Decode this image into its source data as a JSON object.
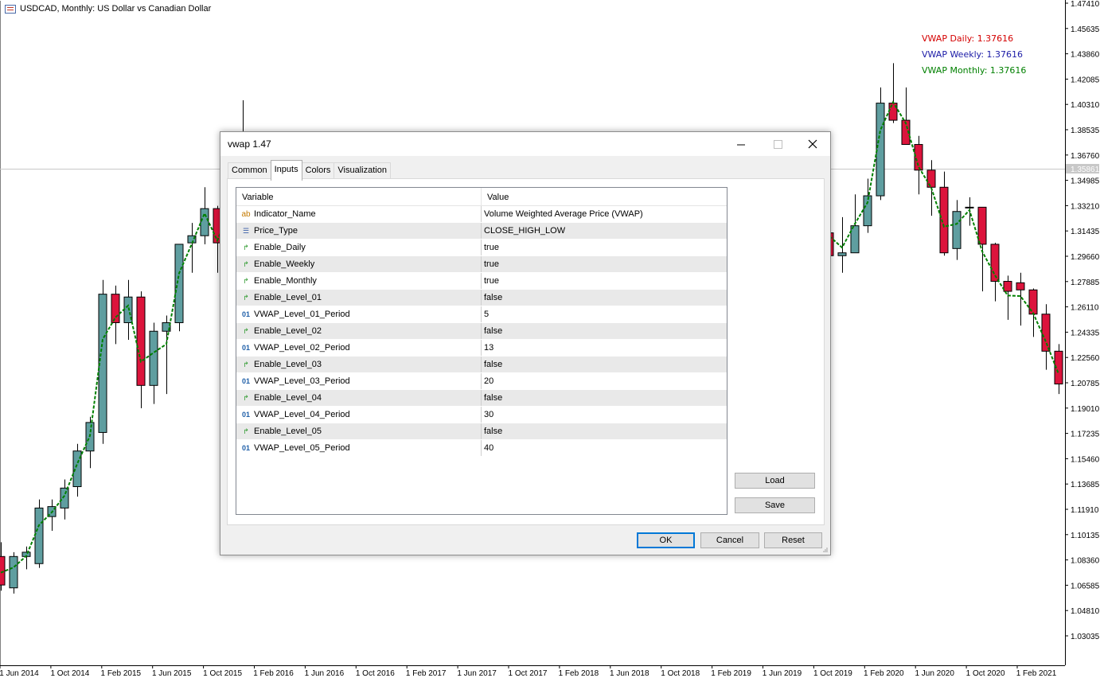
{
  "chart": {
    "symbol_title": "USDCAD, Monthly:  US Dollar vs Canadian Dollar",
    "current_price_label": "1.35861",
    "price_axis": [
      "1.47410",
      "1.45635",
      "1.43860",
      "1.42085",
      "1.40310",
      "1.38535",
      "1.36760",
      "1.34985",
      "1.33210",
      "1.31435",
      "1.29660",
      "1.27885",
      "1.26110",
      "1.24335",
      "1.22560",
      "1.20785",
      "1.19010",
      "1.17235",
      "1.15460",
      "1.13685",
      "1.11910",
      "1.10135",
      "1.08360",
      "1.06585",
      "1.04810",
      "1.03035"
    ],
    "time_axis": [
      "1 Jun 2014",
      "1 Oct 2014",
      "1 Feb 2015",
      "1 Jun 2015",
      "1 Oct 2015",
      "1 Feb 2016",
      "1 Jun 2016",
      "1 Oct 2016",
      "1 Feb 2017",
      "1 Jun 2017",
      "1 Oct 2017",
      "1 Feb 2018",
      "1 Jun 2018",
      "1 Oct 2018",
      "1 Feb 2019",
      "1 Jun 2019",
      "1 Oct 2019",
      "1 Feb 2020",
      "1 Jun 2020",
      "1 Oct 2020",
      "1 Feb 2021"
    ],
    "vwap_labels": [
      {
        "text": "VWAP Daily: 1.37616",
        "color": "#d40000"
      },
      {
        "text": "VWAP Weekly: 1.37616",
        "color": "#1a1aa6"
      },
      {
        "text": "VWAP Monthly: 1.37616",
        "color": "#008000"
      }
    ],
    "colors": {
      "bull": "#5f9ea0",
      "bear": "#dc143c",
      "vwap": "#008000",
      "grid_line": "#c8c8c8"
    }
  },
  "dialog": {
    "title": "vwap 1.47",
    "tabs": [
      "Common",
      "Inputs",
      "Colors",
      "Visualization"
    ],
    "active_tab": "Inputs",
    "columns": {
      "variable": "Variable",
      "value": "Value"
    },
    "rows": [
      {
        "icon": "ab",
        "name": "Indicator_Name",
        "value": "Volume Weighted Average Price (VWAP)"
      },
      {
        "icon": "list",
        "name": "Price_Type",
        "value": "CLOSE_HIGH_LOW"
      },
      {
        "icon": "bool",
        "name": "Enable_Daily",
        "value": "true"
      },
      {
        "icon": "bool",
        "name": "Enable_Weekly",
        "value": "true"
      },
      {
        "icon": "bool",
        "name": "Enable_Monthly",
        "value": "true"
      },
      {
        "icon": "bool",
        "name": "Enable_Level_01",
        "value": "false"
      },
      {
        "icon": "num",
        "name": "VWAP_Level_01_Period",
        "value": "5"
      },
      {
        "icon": "bool",
        "name": "Enable_Level_02",
        "value": "false"
      },
      {
        "icon": "num",
        "name": "VWAP_Level_02_Period",
        "value": "13"
      },
      {
        "icon": "bool",
        "name": "Enable_Level_03",
        "value": "false"
      },
      {
        "icon": "num",
        "name": "VWAP_Level_03_Period",
        "value": "20"
      },
      {
        "icon": "bool",
        "name": "Enable_Level_04",
        "value": "false"
      },
      {
        "icon": "num",
        "name": "VWAP_Level_04_Period",
        "value": "30"
      },
      {
        "icon": "bool",
        "name": "Enable_Level_05",
        "value": "false"
      },
      {
        "icon": "num",
        "name": "VWAP_Level_05_Period",
        "value": "40"
      }
    ],
    "buttons": {
      "load": "Load",
      "save": "Save",
      "ok": "OK",
      "cancel": "Cancel",
      "reset": "Reset"
    }
  }
}
